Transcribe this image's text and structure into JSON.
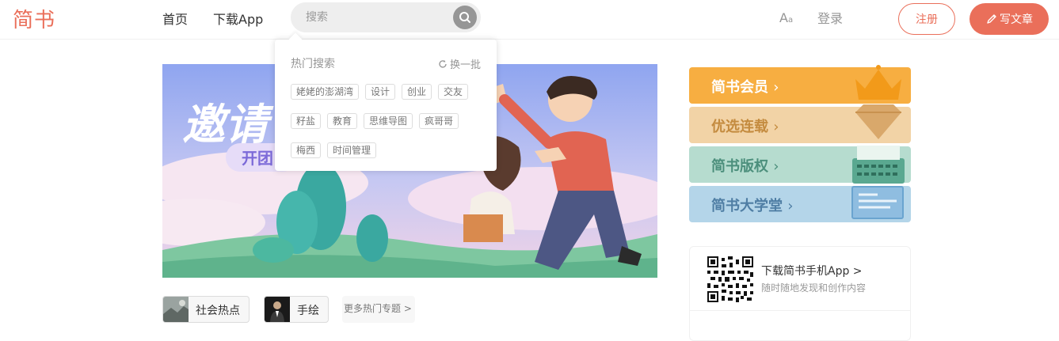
{
  "brand": {
    "logo": "简书",
    "accent": "#ea6f5a"
  },
  "nav": {
    "home": "首页",
    "download": "下载App",
    "search_placeholder": "搜索",
    "font_toggle": "A",
    "font_toggle_small": "a",
    "login": "登录",
    "register": "注册",
    "write": "写文章"
  },
  "hot_search": {
    "title": "热门搜索",
    "refresh": "换一批",
    "tags": [
      "姥姥的澎湖湾",
      "设计",
      "创业",
      "交友",
      "籽盐",
      "教育",
      "思维导图",
      "疯哥哥",
      "梅西",
      "时间管理"
    ]
  },
  "banner": {
    "headline_text": "邀请",
    "sub_text": "开团"
  },
  "sidebar": {
    "cards": [
      {
        "label": "简书会员",
        "color": "#f7ae41"
      },
      {
        "label": "优选连载",
        "color": "#f2d3a6"
      },
      {
        "label": "简书版权",
        "color": "#b6dccf"
      },
      {
        "label": "简书大学堂",
        "color": "#b4d5e9"
      }
    ],
    "chevron": "›"
  },
  "app_download": {
    "title": "下载简书手机App >",
    "subtitle": "随时随地发现和创作内容"
  },
  "topics": {
    "items": [
      "社会热点",
      "手绘"
    ],
    "more": "更多热门专题 >"
  },
  "icons": {
    "search": "search-icon",
    "pen": "pen-icon",
    "refresh": "refresh-icon",
    "qr": "qr-code-icon"
  }
}
